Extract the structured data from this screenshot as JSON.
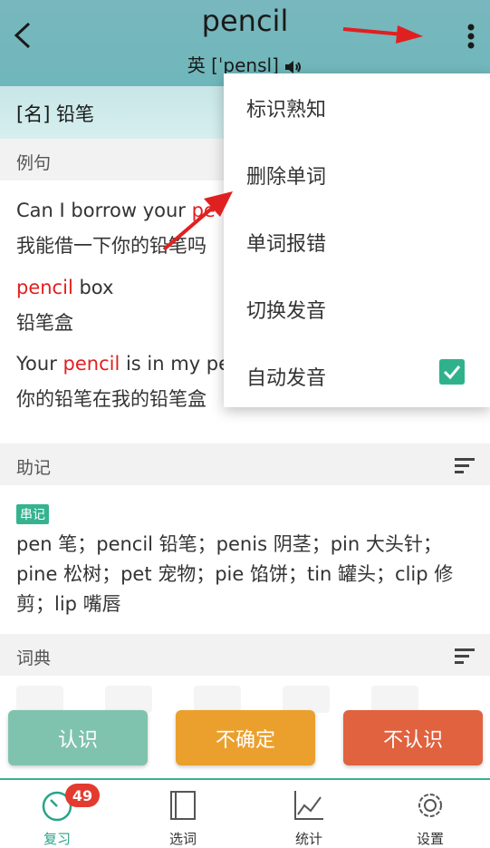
{
  "header": {
    "word": "pencil",
    "phonetic_region": "英",
    "phonetic": "[ˈpensl]"
  },
  "definition": "[名] 铅笔",
  "examples_section": {
    "title": "例句"
  },
  "examples": [
    {
      "en_pre": "Can I borrow your ",
      "en_hl": "pe",
      "en_post": "",
      "zh": "我能借一下你的铅笔吗"
    },
    {
      "en_pre": "",
      "en_hl": "pencil",
      "en_post": " box",
      "zh": "铅笔盒"
    },
    {
      "en_pre": "Your ",
      "en_hl": "pencil",
      "en_post": " is in my pe",
      "zh": "你的铅笔在我的铅笔盒"
    }
  ],
  "mnemonic_section": {
    "title": "助记",
    "tag": "串记",
    "text": "pen 笔；pencil 铅笔；penis 阴茎；pin 大头针；pine 松树；pet 宠物；pie 馅饼；tin 罐头；clip 修剪；lip 嘴唇"
  },
  "dictionary_section": {
    "title": "词典"
  },
  "actions": {
    "know": "认识",
    "unsure": "不确定",
    "unknown": "不认识"
  },
  "colors": {
    "know": "#7fc3ae",
    "unsure": "#eba02d",
    "unknown": "#e0623f",
    "accent": "#2fb28c"
  },
  "menu": {
    "items": [
      "标识熟知",
      "删除单词",
      "单词报错",
      "切换发音",
      "自动发音"
    ],
    "auto_checked": true
  },
  "tabs": [
    {
      "label": "复习",
      "icon": "review-timer-icon",
      "active": true
    },
    {
      "label": "选词",
      "icon": "book-icon",
      "active": false
    },
    {
      "label": "统计",
      "icon": "chart-icon",
      "active": false
    },
    {
      "label": "设置",
      "icon": "gear-icon",
      "active": false
    }
  ],
  "review_count": "49"
}
